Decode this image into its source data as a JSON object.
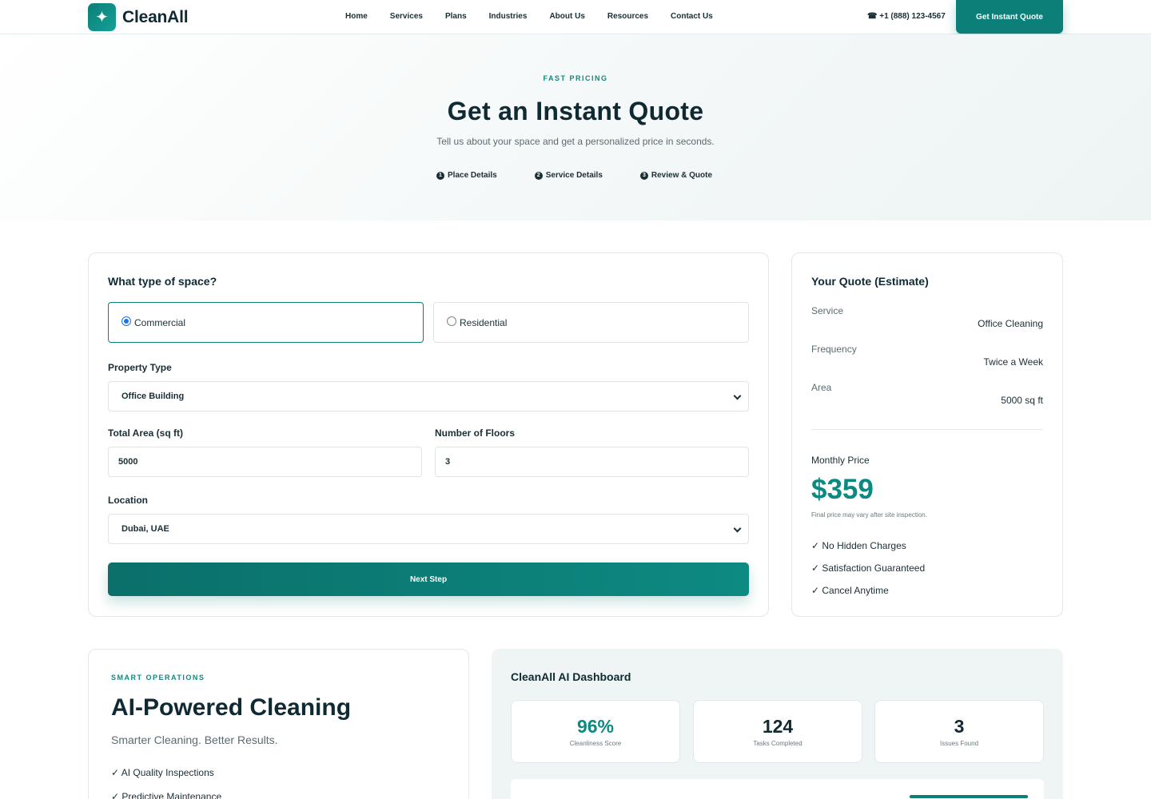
{
  "brand": {
    "name": "CleanAll",
    "mark_icon": "sparkle-icon",
    "accent": "#0c7f78"
  },
  "nav": {
    "items": [
      "Home",
      "Services",
      "Plans",
      "Industries",
      "About Us",
      "Resources",
      "Contact Us"
    ],
    "phone": "☎ +1 (888) 123-4567",
    "cta": "Get Instant Quote"
  },
  "hero": {
    "eyebrow": "FAST PRICING",
    "title": "Get an Instant Quote",
    "subtitle": "Tell us about your space and get a personalized price in seconds.",
    "steps": [
      {
        "num": "1",
        "label": "Place Details"
      },
      {
        "num": "2",
        "label": "Service Details"
      },
      {
        "num": "3",
        "label": "Review & Quote"
      }
    ]
  },
  "form": {
    "question": "What type of space?",
    "options": [
      {
        "label": "Commercial",
        "selected": true
      },
      {
        "label": "Residential",
        "selected": false
      }
    ],
    "property_type": {
      "label": "Property Type",
      "value": "Office Building"
    },
    "area": {
      "label": "Total Area (sq ft)",
      "value": "5000"
    },
    "floors": {
      "label": "Number of Floors",
      "value": "3"
    },
    "location": {
      "label": "Location",
      "value": "Dubai, UAE"
    },
    "next": "Next Step"
  },
  "quote": {
    "title": "Your Quote (Estimate)",
    "rows": [
      {
        "label": "Service",
        "value": "Office Cleaning"
      },
      {
        "label": "Frequency",
        "value": "Twice a Week"
      },
      {
        "label": "Area",
        "value": "5000 sq ft"
      }
    ],
    "price_label": "Monthly Price",
    "price": "$359",
    "note": "Final price may vary after site inspection.",
    "benefits": [
      "✓ No Hidden Charges",
      "✓ Satisfaction Guaranteed",
      "✓ Cancel Anytime"
    ]
  },
  "ai": {
    "eyebrow": "SMART OPERATIONS",
    "title": "AI-Powered Cleaning",
    "subtitle": "Smarter Cleaning. Better Results.",
    "items": [
      "✓ AI Quality Inspections",
      "✓ Predictive Maintenance"
    ]
  },
  "dashboard": {
    "title": "CleanAll AI Dashboard",
    "stats": [
      {
        "value": "96%",
        "label": "Cleanliness Score"
      },
      {
        "value": "124",
        "label": "Tasks Completed"
      },
      {
        "value": "3",
        "label": "Issues Found"
      }
    ]
  }
}
